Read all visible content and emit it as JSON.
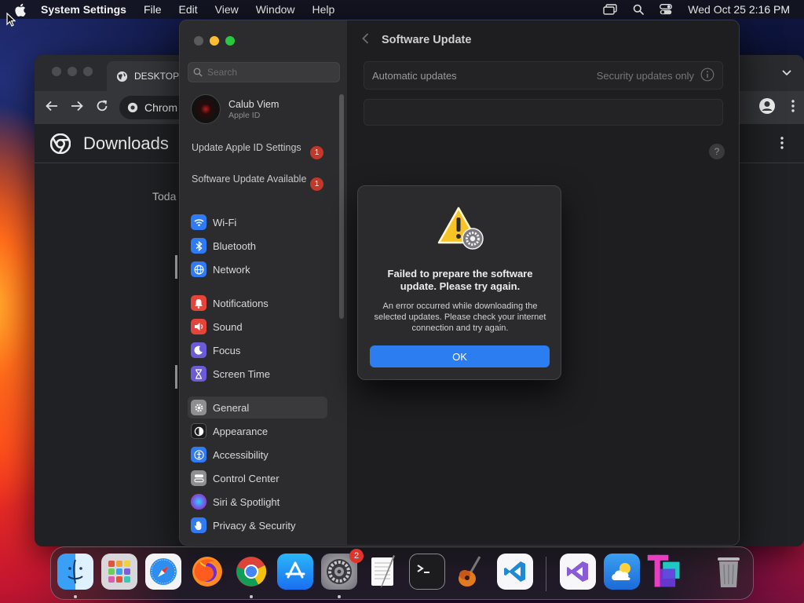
{
  "menubar": {
    "app_name": "System Settings",
    "items": [
      "File",
      "Edit",
      "View",
      "Window",
      "Help"
    ],
    "clock": "Wed Oct 25  2:16 PM"
  },
  "chrome": {
    "tab_title": "DESKTOP",
    "omnibox_text": "Chrom",
    "page_title": "Downloads",
    "today_label": "Toda"
  },
  "settings": {
    "search_placeholder": "Search",
    "account": {
      "name": "Calub Viem",
      "sub": "Apple ID"
    },
    "notices": [
      {
        "label": "Update Apple ID Settings",
        "count": "1"
      },
      {
        "label": "Software Update Available",
        "count": "1"
      }
    ],
    "sidebar_items": [
      {
        "label": "Wi-Fi",
        "icon": "wifi-icon",
        "color": "#2f7bf6"
      },
      {
        "label": "Bluetooth",
        "icon": "bluetooth-icon",
        "color": "#2f7bf6"
      },
      {
        "label": "Network",
        "icon": "globe-icon",
        "color": "#2f7bf6"
      },
      {
        "label": "Notifications",
        "icon": "bell-icon",
        "color": "#e5443a"
      },
      {
        "label": "Sound",
        "icon": "speaker-icon",
        "color": "#e5443a"
      },
      {
        "label": "Focus",
        "icon": "moon-icon",
        "color": "#6b5bd6"
      },
      {
        "label": "Screen Time",
        "icon": "hourglass-icon",
        "color": "#6b5bd6"
      },
      {
        "label": "General",
        "icon": "gear-icon",
        "color": "#8e8e93",
        "active": true
      },
      {
        "label": "Appearance",
        "icon": "appearance-icon",
        "color": "#1c1c1e"
      },
      {
        "label": "Accessibility",
        "icon": "accessibility-icon",
        "color": "#2f7bf6"
      },
      {
        "label": "Control Center",
        "icon": "control-center-icon",
        "color": "#8e8e93"
      },
      {
        "label": "Siri & Spotlight",
        "icon": "siri-icon",
        "color": "#c55bd6"
      },
      {
        "label": "Privacy & Security",
        "icon": "hand-icon",
        "color": "#2f7bf6"
      }
    ],
    "content": {
      "title": "Software Update",
      "auto_updates_label": "Automatic updates",
      "auto_updates_value": "Security updates only",
      "help": "?"
    }
  },
  "alert": {
    "title": "Failed to prepare the software update. Please try again.",
    "body": "An error occurred while downloading the selected updates. Please check your internet connection and try again.",
    "ok_label": "OK"
  },
  "dock": {
    "apps": [
      {
        "name": "finder-icon",
        "running": true
      },
      {
        "name": "launchpad-icon",
        "running": false
      },
      {
        "name": "safari-icon",
        "running": false
      },
      {
        "name": "firefox-icon",
        "running": false
      },
      {
        "name": "chrome-icon",
        "running": true
      },
      {
        "name": "app-store-icon",
        "running": false
      },
      {
        "name": "system-settings-icon",
        "running": true,
        "badge": "2"
      },
      {
        "name": "textedit-icon",
        "running": false
      },
      {
        "name": "terminal-icon",
        "running": false
      },
      {
        "name": "garageband-icon",
        "running": false
      },
      {
        "name": "vscode-icon",
        "running": false
      },
      {
        "name": "visual-studio-icon",
        "running": false
      },
      {
        "name": "weather-icon",
        "running": false
      },
      {
        "name": "tableplus-icon",
        "running": false
      },
      {
        "name": "trash-icon",
        "running": false
      }
    ]
  }
}
